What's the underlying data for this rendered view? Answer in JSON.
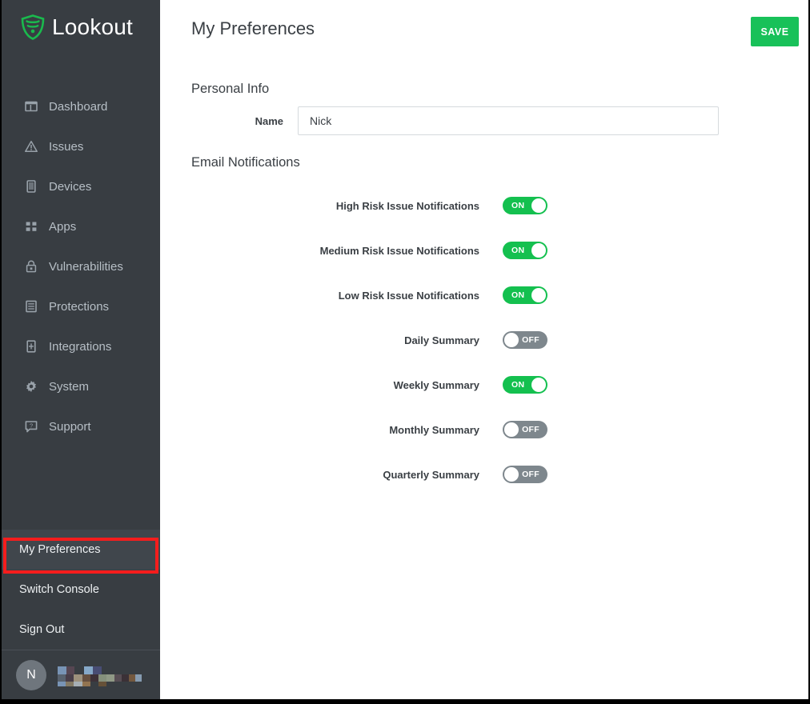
{
  "brand": {
    "name": "Lookout",
    "logo_icon": "shield-icon",
    "accent_green": "#14c04f",
    "sidebar_bg": "#383d42",
    "highlight_red": "#f51d1d"
  },
  "sidebar": {
    "items": [
      {
        "label": "Dashboard",
        "icon": "dashboard-icon"
      },
      {
        "label": "Issues",
        "icon": "warning-triangle-icon"
      },
      {
        "label": "Devices",
        "icon": "device-phone-icon"
      },
      {
        "label": "Apps",
        "icon": "grid-apps-icon"
      },
      {
        "label": "Vulnerabilities",
        "icon": "lock-icon"
      },
      {
        "label": "Protections",
        "icon": "document-list-icon"
      },
      {
        "label": "Integrations",
        "icon": "integration-icon"
      },
      {
        "label": "System",
        "icon": "gear-icon"
      },
      {
        "label": "Support",
        "icon": "help-bubble-icon"
      }
    ],
    "account_items": [
      {
        "label": "My Preferences",
        "selected": true
      },
      {
        "label": "Switch Console",
        "selected": false
      },
      {
        "label": "Sign Out",
        "selected": false
      }
    ],
    "profile": {
      "avatar_initial": "N",
      "username": ""
    }
  },
  "header": {
    "title": "My Preferences",
    "save_label": "SAVE"
  },
  "personal_info": {
    "section_title": "Personal Info",
    "name_label": "Name",
    "name_value": "Nick",
    "name_placeholder": ""
  },
  "email_notifications": {
    "section_title": "Email Notifications",
    "on_text": "ON",
    "off_text": "OFF",
    "toggles": [
      {
        "label": "High Risk Issue Notifications",
        "state": "on"
      },
      {
        "label": "Medium Risk Issue Notifications",
        "state": "on"
      },
      {
        "label": "Low Risk Issue Notifications",
        "state": "on"
      },
      {
        "label": "Daily Summary",
        "state": "off"
      },
      {
        "label": "Weekly Summary",
        "state": "on"
      },
      {
        "label": "Monthly Summary",
        "state": "off"
      },
      {
        "label": "Quarterly Summary",
        "state": "off"
      }
    ]
  }
}
